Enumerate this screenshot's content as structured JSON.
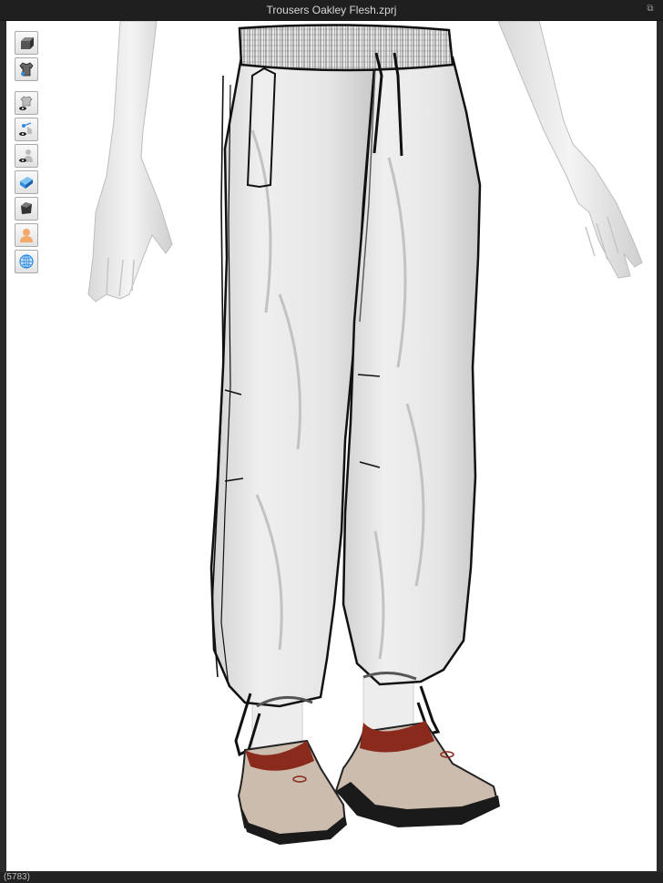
{
  "window": {
    "title": "Trousers Oakley Flesh.zprj",
    "detach_label": "⧉"
  },
  "status": {
    "text": "(5783)"
  },
  "toolbar": {
    "group1": [
      {
        "name": "avatar-display-icon"
      },
      {
        "name": "garment-display-icon"
      }
    ],
    "group2": [
      {
        "name": "show-garment-icon"
      },
      {
        "name": "show-arrangement-points-icon"
      },
      {
        "name": "show-avatar-icon"
      },
      {
        "name": "texture-surface-icon"
      },
      {
        "name": "render-mode-icon"
      },
      {
        "name": "skin-avatar-icon"
      },
      {
        "name": "environment-globe-icon"
      }
    ]
  },
  "colors": {
    "accent_blue": "#2f8ce0",
    "shoe_red": "#8a2a1c",
    "shoe_tan": "#cbbcae",
    "sole_black": "#1a1a1a"
  }
}
